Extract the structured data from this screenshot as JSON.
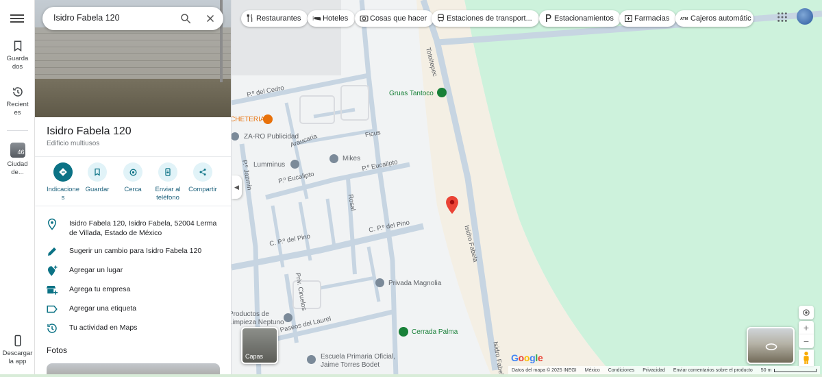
{
  "search": {
    "query": "Isidro Fabela 120"
  },
  "rail": {
    "saved": "Guardados",
    "recent": "Recientes",
    "city_badge": "46",
    "city": "Ciudad de...",
    "download": "Descargar la app"
  },
  "place": {
    "name": "Isidro Fabela 120",
    "category": "Edificio multiusos"
  },
  "actions": [
    {
      "label": "Indicaciones",
      "icon": "directions-icon"
    },
    {
      "label": "Guardar",
      "icon": "bookmark-icon"
    },
    {
      "label": "Cerca",
      "icon": "nearby-icon"
    },
    {
      "label": "Enviar al teléfono",
      "icon": "send-to-phone-icon"
    },
    {
      "label": "Compartir",
      "icon": "share-icon"
    }
  ],
  "info": {
    "address": "Isidro Fabela 120, Isidro Fabela, 52004 Lerma de Villada, Estado de México",
    "suggest": "Sugerir un cambio para Isidro Fabela 120",
    "add_place": "Agregar un lugar",
    "add_business": "Agrega tu empresa",
    "add_label": "Agregar una etiqueta",
    "activity": "Tu actividad en Maps"
  },
  "photos_heading": "Fotos",
  "chips": [
    "Restaurantes",
    "Hoteles",
    "Cosas que hacer",
    "Estaciones de transport...",
    "Estacionamientos",
    "Farmacias",
    "Cajeros automátic"
  ],
  "map": {
    "streets": [
      "P.º del Cedro",
      "P.º Jazmín",
      "P.º Eucalipto",
      "P.º Eucalipto",
      "Ficus",
      "Araucaria",
      "Rosal",
      "C. P.º del Pino",
      "C. P.º del Pino",
      "Priv. Ciruelos",
      "Paseos del Laurel",
      "Totoltepec",
      "Isidro Fabela",
      "Isidro Fabela"
    ],
    "pois": {
      "gruas": "Gruas Tantoco",
      "cafeteria": "CHETERIA",
      "zaro": "ZA-RO Publicidad",
      "lumminus": "Lumminus",
      "mikes": "Mikes",
      "magnolia": "Privada Magnolia",
      "limpieza": "Productos de\nLimpieza Neptuno",
      "palma": "Cerrada Palma",
      "escuela": "Escuela Primaria Oficial,\nJaime Torres Bodet"
    }
  },
  "layers_label": "Capas",
  "google": "Google",
  "footer": [
    "Datos del mapa © 2025 INEGI",
    "México",
    "Condiciones",
    "Privacidad",
    "Enviar comentarios sobre el producto",
    "50 m"
  ],
  "colors": {
    "accent": "#0b7285",
    "pin": "#ea4335",
    "park": "#cdf2dc",
    "road": "#c7d5e2",
    "poi_green": "#188038"
  }
}
